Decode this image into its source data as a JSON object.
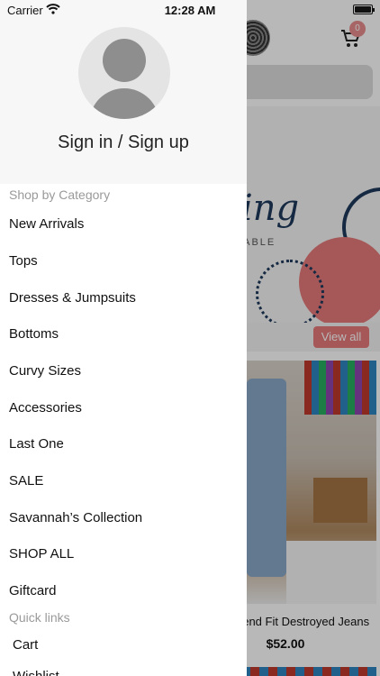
{
  "status_bar": {
    "carrier": "Carrier",
    "time": "12:28 AM"
  },
  "drawer": {
    "sign_in_label": "Sign in / Sign up",
    "category_header": "Shop by Category",
    "categories": [
      "New Arrivals",
      "Tops",
      "Dresses & Jumpsuits",
      "Bottoms",
      "Curvy Sizes",
      "Accessories",
      "Last One",
      "SALE",
      "Savannah’s Collection",
      "SHOP ALL",
      "Giftcard"
    ],
    "quick_links_header": "Quick links",
    "quick_links": [
      "Cart",
      "Wishlist"
    ]
  },
  "background": {
    "cart_count": "0",
    "banner_script_text": "ing",
    "banner_subtext": "LABLE",
    "view_all_label": "View all",
    "product_name": "riend Fit Destroyed Jeans",
    "product_price": "$52.00"
  },
  "colors": {
    "accent": "#e77b7b",
    "navy": "#1f3a5c",
    "drawer_header_bg": "#f7f7f7"
  }
}
